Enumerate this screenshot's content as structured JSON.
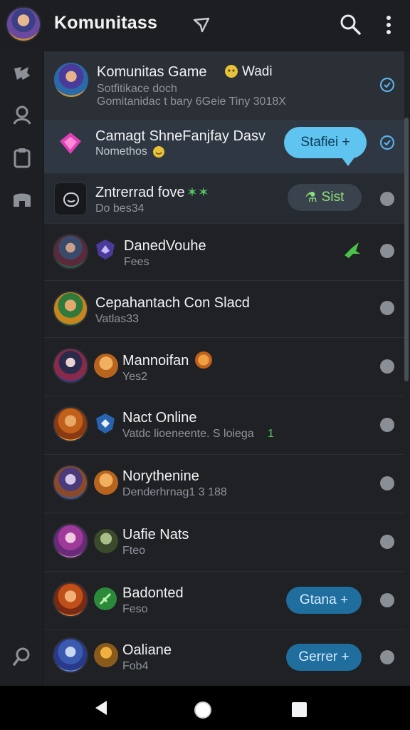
{
  "app": {
    "title": "Komunitass"
  },
  "rows": [
    {
      "name": "Komunitas Game",
      "name_extra": "Wadi",
      "sub": "Sotfitikace doch",
      "sub2": "Gomitanidac t bary 6Geie Tiny 3018X"
    },
    {
      "name": "Camagt ShneFanjfay Dasv",
      "sub": "Nomethos",
      "bubble": "Stafiei +"
    },
    {
      "name": "Zntrerrad fove",
      "sub": "Do bes34",
      "action": "Sist"
    },
    {
      "name": "DanedVouhe",
      "sub": "Fees"
    },
    {
      "name": "Cepahantach Con Slacd",
      "sub": "Vatlas33"
    },
    {
      "name": "Mannoifan",
      "sub": "Yes2"
    },
    {
      "name": "Nact Online",
      "sub": "Vatdc lioeneente. S loiega",
      "sub_extra": "1"
    },
    {
      "name": "Norythenine",
      "sub": "Denderhrnag1 3 188"
    },
    {
      "name": "Uafie Nats",
      "sub": "Fteo"
    },
    {
      "name": "Badonted",
      "sub": "Feso",
      "action": "Gtana +"
    },
    {
      "name": "Oaliane",
      "sub": "Fob4",
      "action": "Gerrer +"
    }
  ],
  "colors": {
    "accent": "#1f6e9e",
    "bubble": "#5fc4f0",
    "online_green": "#8ee27a",
    "check_blue": "#5ab0e8"
  },
  "icons": {
    "rail": [
      "gamepad-icon",
      "person-icon",
      "clipboard-icon",
      "store-icon",
      "search-icon"
    ],
    "nav": [
      "back-icon",
      "home-icon",
      "recents-icon"
    ]
  }
}
